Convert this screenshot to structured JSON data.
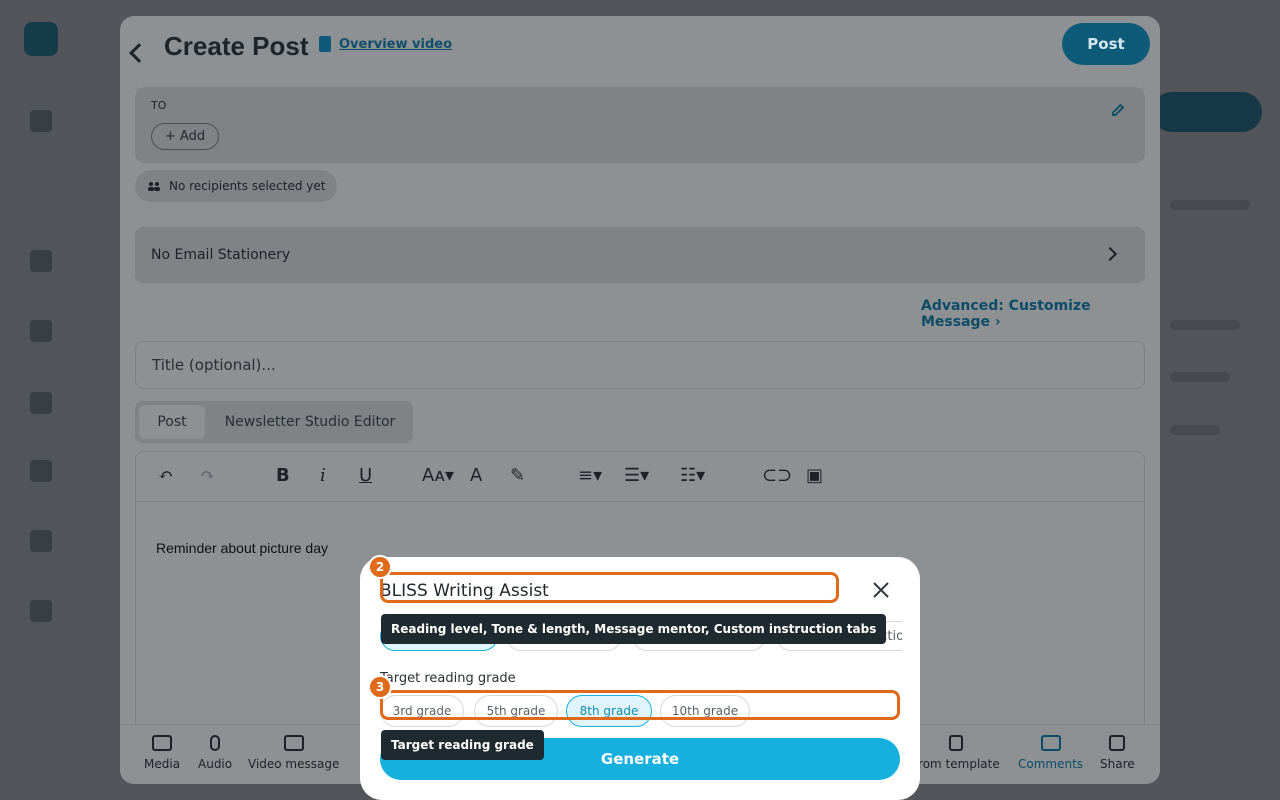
{
  "header": {
    "title": "Create Post",
    "overview_link": "Overview video",
    "post_button": "Post"
  },
  "recipients": {
    "to_label": "TO",
    "add_button": "+ Add",
    "empty_text": "No recipients selected yet"
  },
  "stationery": {
    "label": "No Email Stationery"
  },
  "advanced_link": "Advanced: Customize Message",
  "title_input": {
    "placeholder": "Title (optional)..."
  },
  "editor_tabs": [
    {
      "label": "Post",
      "active": true
    },
    {
      "label": "Newsletter Studio Editor",
      "active": false
    }
  ],
  "editor": {
    "body_text": "Reminder about picture day"
  },
  "bottom_bar": [
    {
      "label": "Media",
      "icon": "camera-icon"
    },
    {
      "label": "Audio",
      "icon": "microphone-icon"
    },
    {
      "label": "Video message",
      "icon": "video-camera-icon"
    },
    {
      "label": "From template",
      "icon": "document-icon"
    },
    {
      "label": "Comments",
      "icon": "comments-icon",
      "active": true
    },
    {
      "label": "Share",
      "icon": "share-icon"
    }
  ],
  "assist": {
    "title": "BLISS Writing Assist",
    "tabs": [
      {
        "label": "Reading level",
        "selected": true
      },
      {
        "label": "Tone & length",
        "selected": false
      },
      {
        "label": "Message mentor",
        "selected": false
      },
      {
        "label": "Custom instructions",
        "selected": false
      }
    ],
    "grade_label": "Target reading grade",
    "grades": [
      {
        "label": "3rd grade",
        "selected": false
      },
      {
        "label": "5th grade",
        "selected": false
      },
      {
        "label": "8th grade",
        "selected": true
      },
      {
        "label": "10th grade",
        "selected": false
      }
    ],
    "generate_button": "Generate"
  },
  "tour": {
    "step2": {
      "number": "2",
      "tip": "Reading level, Tone & length, Message mentor, Custom instruction tabs"
    },
    "step3": {
      "number": "3",
      "tip": "Target reading grade"
    }
  },
  "colors": {
    "accent": "#15b0dd",
    "post_button": "#0e5b79",
    "highlight": "#e06a1b",
    "tooltip_bg": "#1f2a30"
  }
}
